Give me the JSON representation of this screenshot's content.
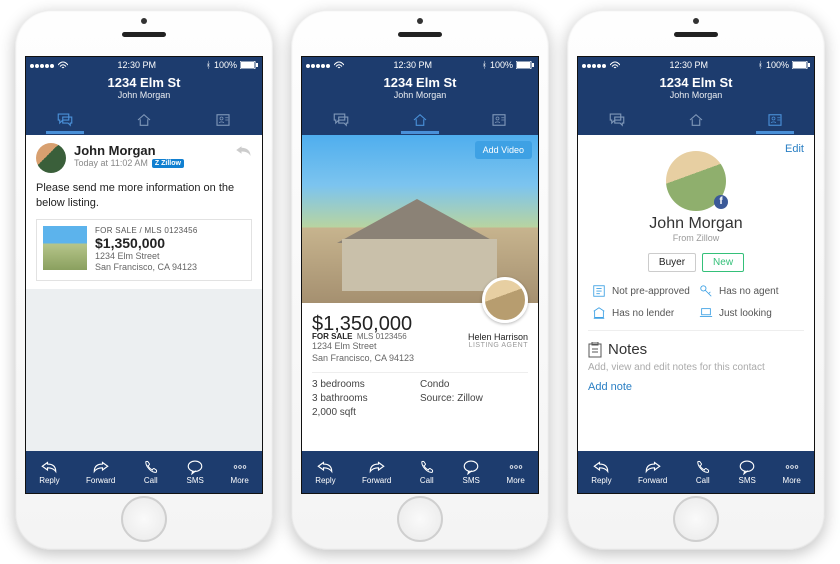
{
  "status": {
    "time": "12:30 PM",
    "battery": "100%"
  },
  "header": {
    "title": "1234 Elm St",
    "sub": "John Morgan"
  },
  "toolbar": {
    "reply": "Reply",
    "forward": "Forward",
    "call": "Call",
    "sms": "SMS",
    "more": "More"
  },
  "p1": {
    "sender": "John Morgan",
    "timestamp": "Today at 11:02 AM",
    "via": "Zillow",
    "message": "Please send me more information on the below listing.",
    "listing": {
      "mls": "FOR SALE / MLS 0123456",
      "price": "$1,350,000",
      "addr1": "1234 Elm Street",
      "addr2": "San Francisco, CA 94123"
    }
  },
  "p2": {
    "button": "Add Video",
    "price": "$1,350,000",
    "sale": "FOR SALE",
    "mls": "MLS 0123456",
    "addr1": "1234 Elm Street",
    "addr2": "San Francisco, CA 94123",
    "agent": "Helen Harrison",
    "agent_role": "LISTING AGENT",
    "facts": {
      "beds": "3 bedrooms",
      "type": "Condo",
      "baths": "3 bathrooms",
      "source": "Source: Zillow",
      "sqft": "2,000 sqft"
    }
  },
  "p3": {
    "edit": "Edit",
    "name": "John Morgan",
    "from": "From Zillow",
    "tags": {
      "buyer": "Buyer",
      "new": "New"
    },
    "stats": {
      "a": "Not pre-approved",
      "b": "Has no agent",
      "c": "Has no lender",
      "d": "Just looking"
    },
    "notes_title": "Notes",
    "notes_sub": "Add, view and edit notes for this contact",
    "add_note": "Add note"
  }
}
